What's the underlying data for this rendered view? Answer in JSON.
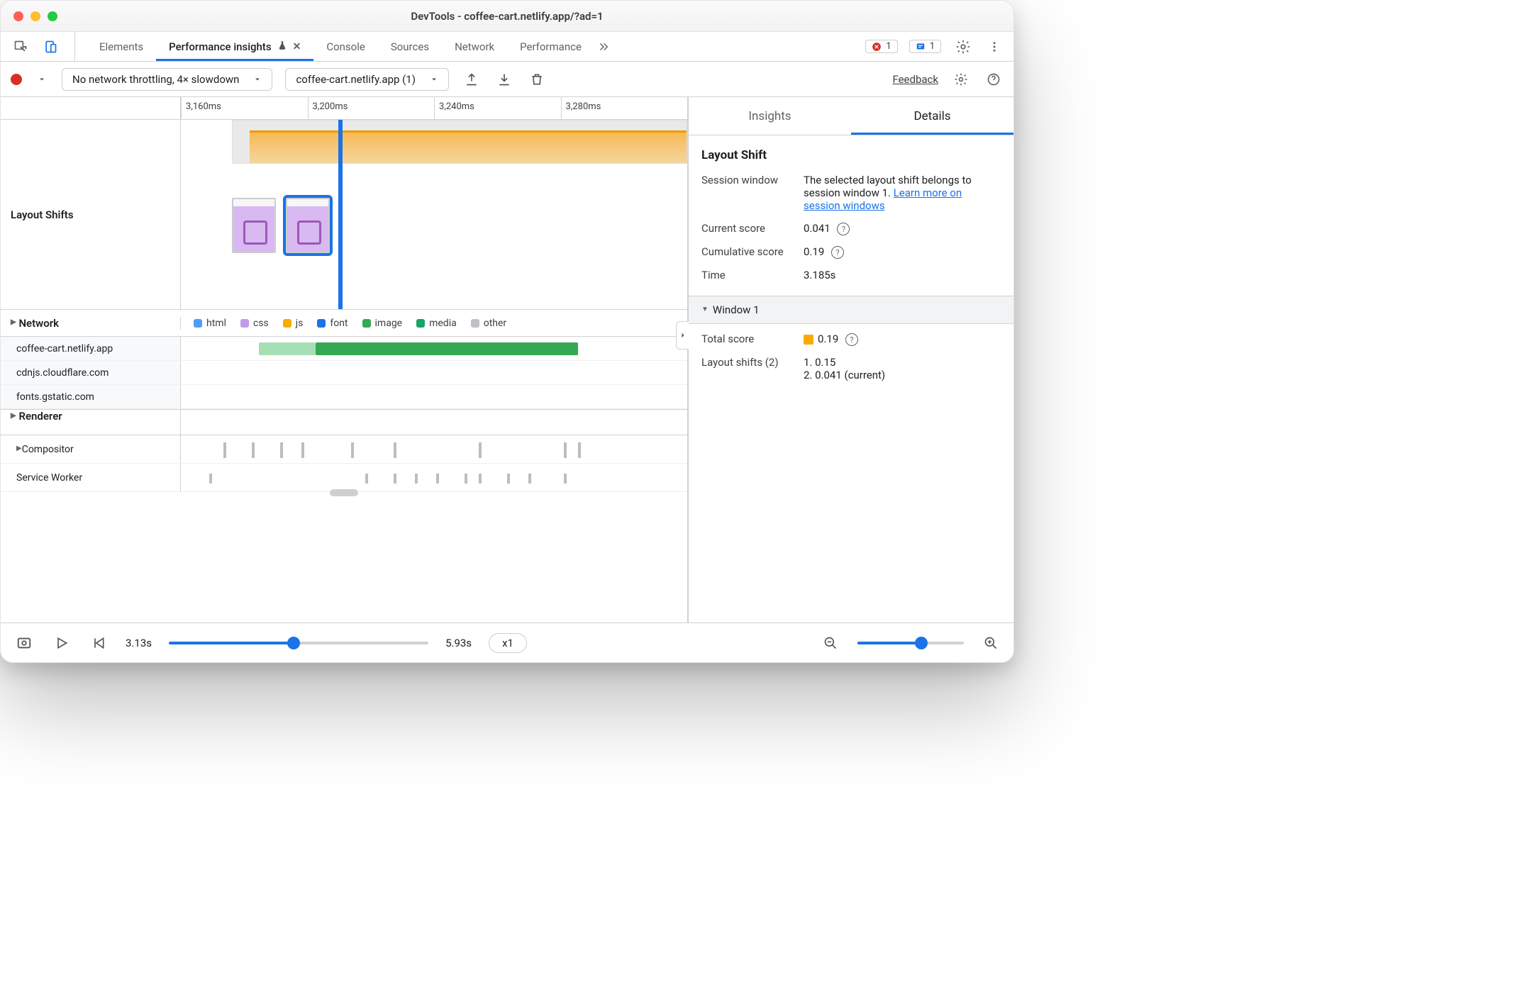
{
  "window": {
    "title": "DevTools - coffee-cart.netlify.app/?ad=1"
  },
  "tabs": {
    "items": [
      "Elements",
      "Performance insights",
      "Console",
      "Sources",
      "Network",
      "Performance"
    ],
    "active_index": 1,
    "experiment_icon": true,
    "error_count": "1",
    "issue_count": "1"
  },
  "toolbar": {
    "throttle": "No network throttling, 4× slowdown",
    "recording": "coffee-cart.netlify.app (1)",
    "feedback": "Feedback"
  },
  "timeline_ticks": [
    "3,160ms",
    "3,200ms",
    "3,240ms",
    "3,280ms"
  ],
  "layout_shifts_label": "Layout Shifts",
  "network": {
    "label": "Network",
    "legend": [
      "html",
      "css",
      "js",
      "font",
      "image",
      "media",
      "other"
    ],
    "hosts": [
      "coffee-cart.netlify.app",
      "cdnjs.cloudflare.com",
      "fonts.gstatic.com"
    ]
  },
  "renderer": {
    "label": "Renderer",
    "sub": [
      "Compositor",
      "Service Worker"
    ]
  },
  "insights_tabs": [
    "Insights",
    "Details"
  ],
  "details": {
    "title": "Layout Shift",
    "session_window_label": "Session window",
    "session_window_text": "The selected layout shift belongs to session window 1. ",
    "learn_link": "Learn more on session windows",
    "current_score_label": "Current score",
    "current_score": "0.041",
    "cumulative_label": "Cumulative score",
    "cumulative": "0.19",
    "time_label": "Time",
    "time": "3.185s",
    "window_section": "Window 1",
    "total_score_label": "Total score",
    "total_score": "0.19",
    "layout_shifts_label": "Layout shifts (2)",
    "shifts": [
      "1. 0.15",
      "2. 0.041 (current)"
    ]
  },
  "playbar": {
    "start": "3.13s",
    "end": "5.93s",
    "speed": "x1"
  }
}
